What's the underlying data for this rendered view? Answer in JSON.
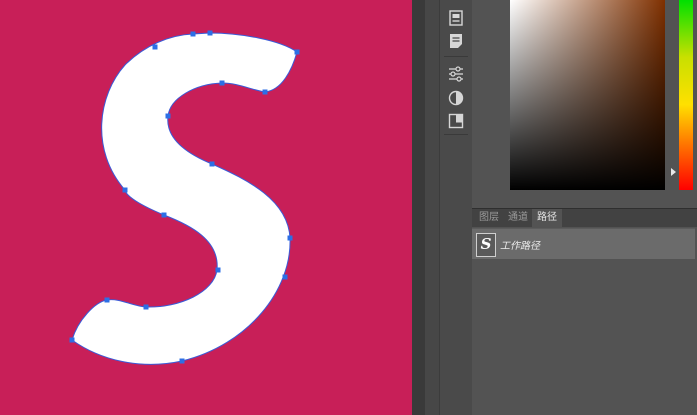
{
  "canvas": {
    "background_color": "#c81f58",
    "letter_fill": "#ffffff",
    "path_color": "#3b5bd8",
    "anchor_color": "#2c6fe6"
  },
  "toolbar": {
    "icons": [
      "history-icon",
      "actions-icon",
      "adjustments-icon",
      "styles-icon",
      "properties-icon"
    ]
  },
  "color_picker": {
    "hue_colors": [
      "#00e000",
      "#ffe000",
      "#ff7a00",
      "#ff0000"
    ]
  },
  "panel": {
    "tabs": [
      {
        "label": "图层",
        "active": false
      },
      {
        "label": "通道",
        "active": false
      },
      {
        "label": "路径",
        "active": true
      }
    ],
    "paths": [
      {
        "name": "工作路径",
        "thumb_letter": "S"
      }
    ]
  }
}
